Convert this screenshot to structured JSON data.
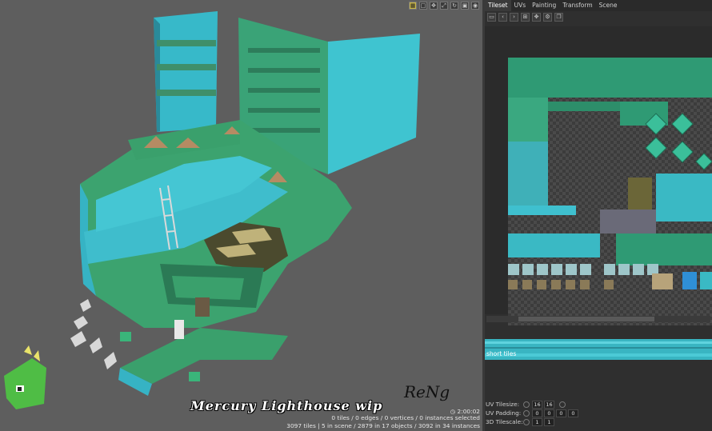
{
  "viewport": {
    "toolbar_icons": [
      "grid-icon",
      "frame-icon",
      "transform-icon",
      "scale-icon",
      "rotate-icon",
      "select-icon",
      "camera-icon"
    ],
    "caption": "Mercury Lighthouse wip",
    "signature": "ReNg",
    "clock": "2:00:02",
    "status_line1": "0 tiles / 0 edges / 0 vertices / 0 instances selected",
    "status_line2": "3097 tiles | 5 in scene / 2879 in 17 objects / 3092 in 34 instances"
  },
  "panel": {
    "tabs": [
      "Tileset",
      "UVs",
      "Painting",
      "Transform",
      "Scene"
    ],
    "active_tab": "Tileset",
    "toolbar_icons": [
      "image-icon",
      "prev-icon",
      "next-icon",
      "grid-toggle-icon",
      "move-icon",
      "settings-icon",
      "copy-icon"
    ],
    "strip_label": "short tiles",
    "props": {
      "uv_tilesize_label": "UV Tilesize:",
      "uv_tilesize": [
        "16",
        "16"
      ],
      "uv_padding_label": "UV Padding:",
      "uv_padding": [
        "0",
        "0",
        "0",
        "0"
      ],
      "tilescale_label": "3D Tilescale:",
      "tilescale": [
        "1",
        "1"
      ]
    }
  },
  "colors": {
    "teal": "#3fc8d2",
    "green": "#3a9e6e",
    "dark_green": "#2b7a55",
    "accent_yellow": "#c9b64a"
  }
}
